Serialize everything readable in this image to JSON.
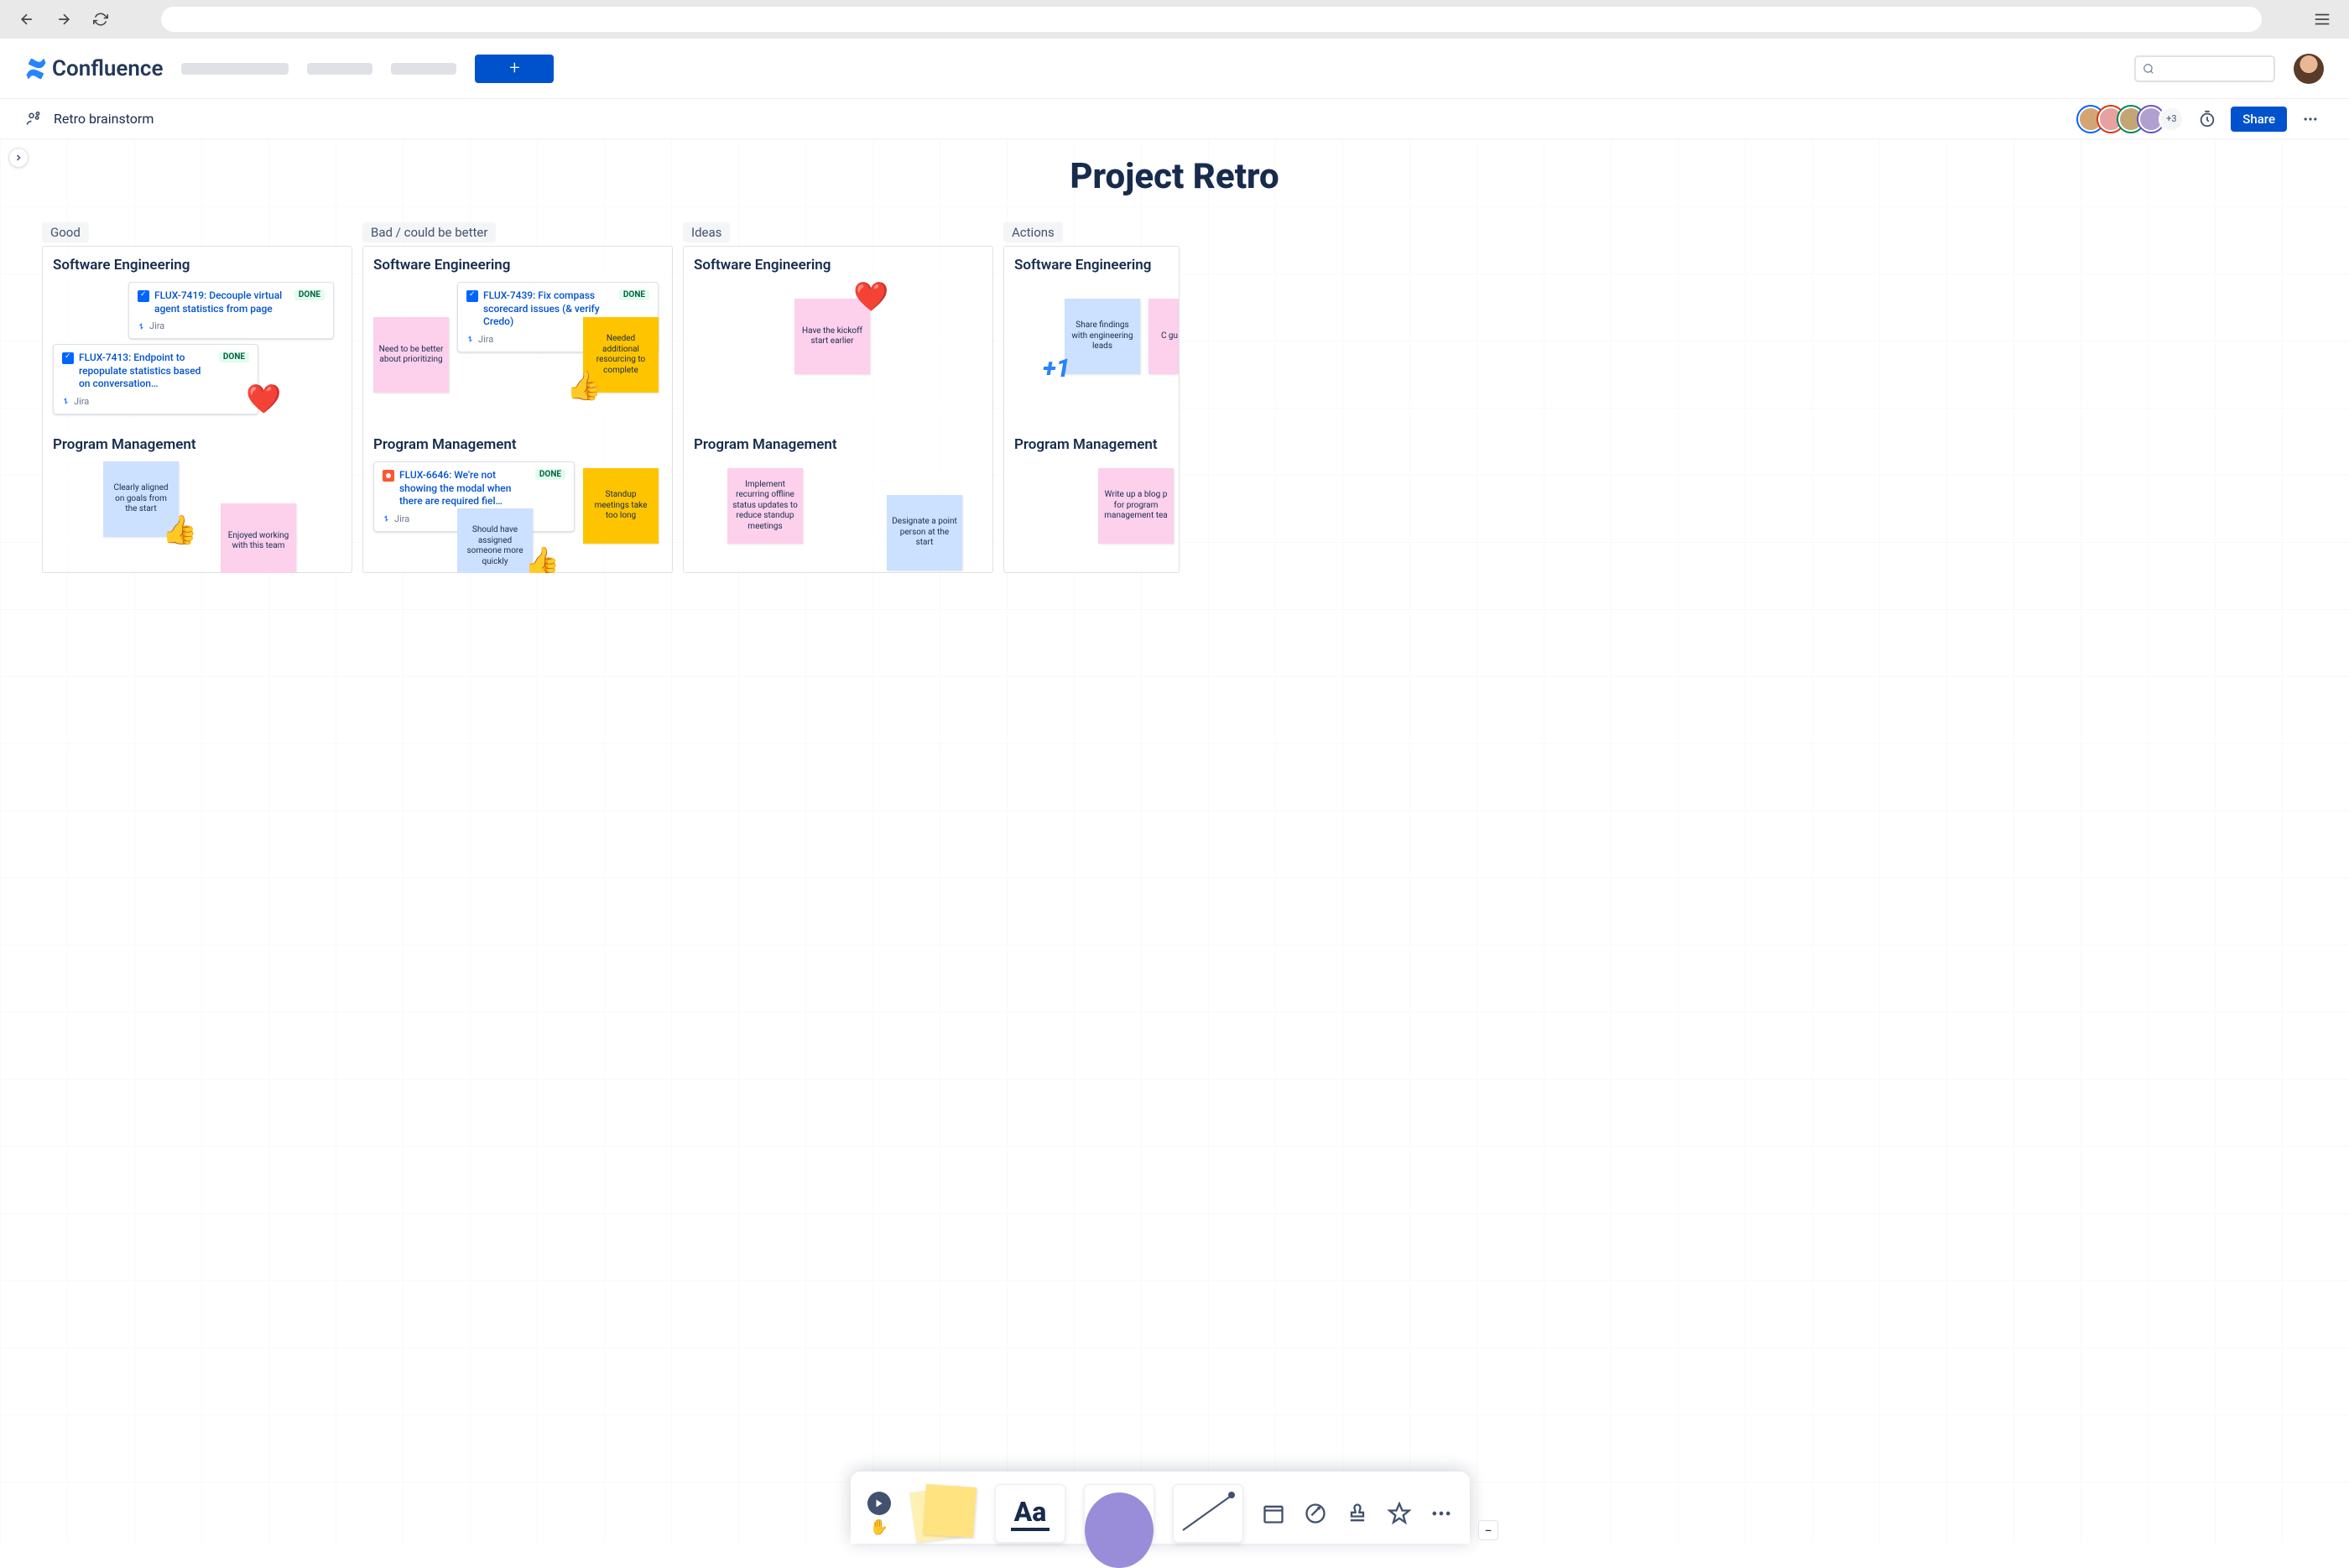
{
  "chrome": {},
  "nav": {
    "brand": "Confluence",
    "create_label": "+"
  },
  "header": {
    "breadcrumb": "Retro brainstorm",
    "collab_extra": "+3",
    "share": "Share"
  },
  "board": {
    "title": "Project Retro",
    "columns": [
      {
        "label": "Good",
        "sections": [
          {
            "heading": "Software Engineering",
            "jira": [
              {
                "key": "FLUX-7419",
                "text": "FLUX-7419: Decouple virtual agent statistics from page",
                "status": "DONE",
                "meta": "Jira"
              },
              {
                "key": "FLUX-7413",
                "text": "FLUX-7413: Endpoint to repopulate statistics based on conversation…",
                "status": "DONE",
                "meta": "Jira"
              }
            ],
            "stickies": []
          },
          {
            "heading": "Program Management",
            "stickies": [
              {
                "text": "Clearly aligned on goals from the start",
                "color": "blue"
              },
              {
                "text": "Enjoyed working with this team",
                "color": "pink"
              }
            ]
          }
        ]
      },
      {
        "label": "Bad / could be better",
        "sections": [
          {
            "heading": "Software Engineering",
            "jira": [
              {
                "key": "FLUX-7439",
                "text": "FLUX-7439: Fix compass scorecard issues (& verify Credo)",
                "status": "DONE",
                "meta": "Jira"
              }
            ],
            "stickies": [
              {
                "text": "Need to be better about prioritizing",
                "color": "pink"
              },
              {
                "text": "Needed additional resourcing to complete",
                "color": "orange"
              }
            ]
          },
          {
            "heading": "Program Management",
            "jira": [
              {
                "key": "FLUX-6646",
                "text": "FLUX-6646: We're not showing the modal when there are required fiel…",
                "status": "DONE",
                "meta": "Jira",
                "bug": true
              }
            ],
            "stickies": [
              {
                "text": "Should have assigned someone more quickly",
                "color": "blue"
              },
              {
                "text": "Standup meetings take too long",
                "color": "orange"
              }
            ]
          }
        ]
      },
      {
        "label": "Ideas",
        "sections": [
          {
            "heading": "Software Engineering",
            "stickies": [
              {
                "text": "Have the kickoff start earlier",
                "color": "pink"
              }
            ]
          },
          {
            "heading": "Program Management",
            "stickies": [
              {
                "text": "Implement recurring offline status updates to reduce standup meetings",
                "color": "pink"
              },
              {
                "text": "Designate a point person at the start",
                "color": "blue"
              }
            ]
          }
        ]
      },
      {
        "label": "Actions",
        "sections": [
          {
            "heading": "Software Engineering",
            "stickies": [
              {
                "text": "Share findings with engineering leads",
                "color": "blue"
              },
              {
                "text": "C gu",
                "color": "pink"
              }
            ]
          },
          {
            "heading": "Program Management",
            "stickies": [
              {
                "text": "Write up a blog p for program management tea",
                "color": "pink"
              }
            ]
          }
        ]
      }
    ]
  },
  "toolbar": {
    "text_tool": "Aa",
    "collapse": "−"
  },
  "colors": {
    "primary": "#0052CC",
    "text": "#172B4D",
    "blue_sticky": "#CCE0FF",
    "pink_sticky": "#FDD0EC",
    "orange_sticky": "#FFC400"
  }
}
